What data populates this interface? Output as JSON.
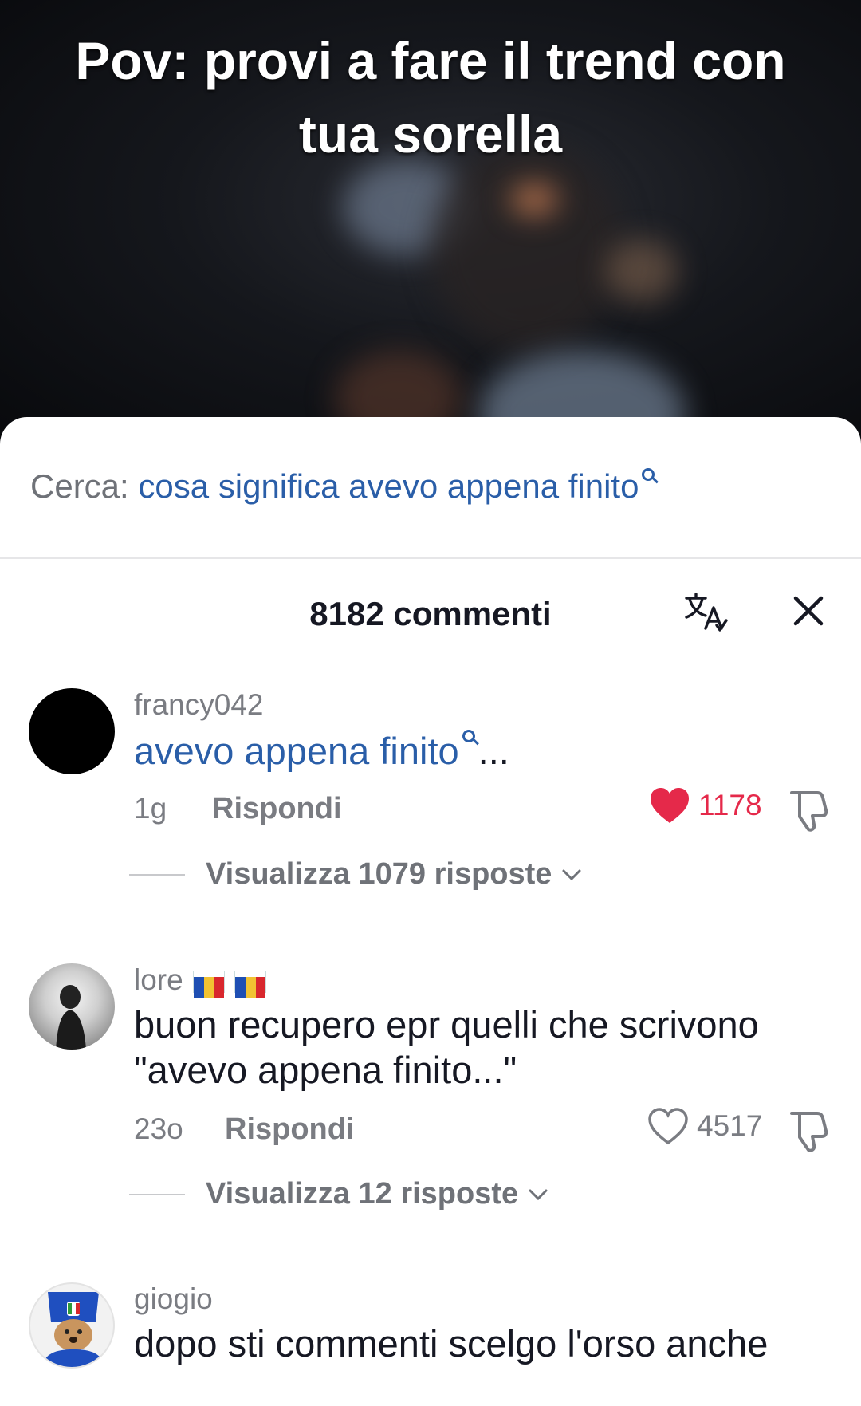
{
  "video": {
    "caption": "Pov: provi a fare il trend con tua sorella"
  },
  "search_suggestion": {
    "prefix": "Cerca:",
    "query": "cosa significa avevo appena finito"
  },
  "comments_panel": {
    "title": "8182 commenti",
    "translate_icon": "translate-icon",
    "close_icon": "close-icon"
  },
  "comments": [
    {
      "username": "francy042",
      "text": "avevo appena finito",
      "text_suffix": "...",
      "time": "1g",
      "reply_label": "Rispondi",
      "likes": "1178",
      "liked": true,
      "view_replies": "Visualizza 1079 risposte"
    },
    {
      "username": "lore",
      "text": "buon recupero epr quelli che scrivono \"avevo appena finito...\"",
      "time": "23o",
      "reply_label": "Rispondi",
      "likes": "4517",
      "liked": false,
      "view_replies": "Visualizza 12 risposte"
    },
    {
      "username": "giogio",
      "text": "dopo sti commenti scelgo l'orso anche"
    }
  ],
  "colors": {
    "link_blue": "#2a5ea8",
    "like_red": "#e5294a",
    "muted_gray": "#7a7c82"
  }
}
